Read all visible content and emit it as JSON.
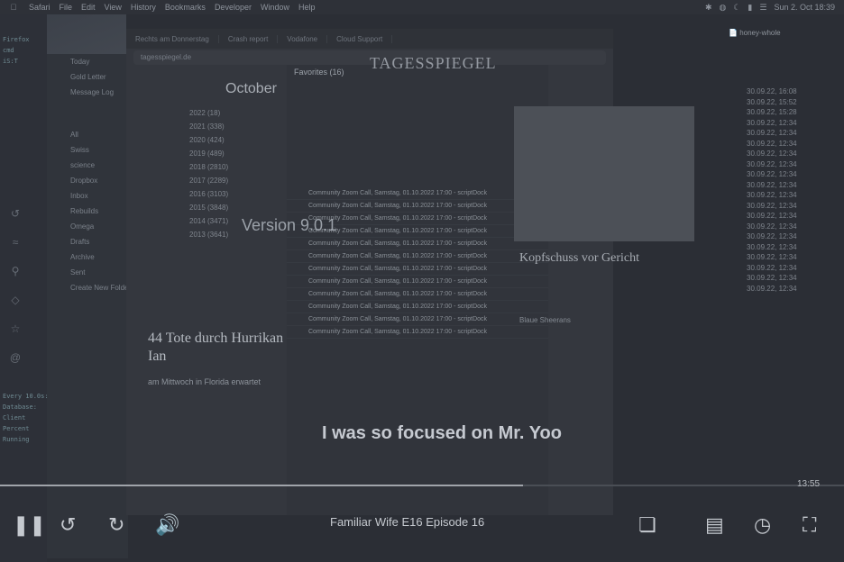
{
  "menubar": {
    "apple_icon": "apple-logo",
    "items": [
      "Safari",
      "File",
      "Edit",
      "View",
      "History",
      "Bookmarks",
      "Developer",
      "Window",
      "Help"
    ],
    "datetime": "Sun 2. Oct  18:39",
    "status_icons": [
      "bluetooth-icon",
      "wifi-icon",
      "moon-icon",
      "battery-icon",
      "control-center-icon"
    ]
  },
  "terminal": {
    "lines": [
      "Firefox",
      "cmd",
      "iS:T",
      "Every 10.0s: ss",
      "Database:",
      "Client",
      "Percent",
      "Running"
    ]
  },
  "mail": {
    "folders": [
      "Today",
      "Gold Letter",
      "Message Log",
      "All",
      "Swiss",
      "science",
      "Dropbox",
      "Inbox",
      "Rebuilds",
      "Omega",
      "Drafts",
      "Archive",
      "Sent",
      "Create New Folder"
    ]
  },
  "browser": {
    "tabs": [
      "Rechts am Donnerstag",
      "Crash report",
      "Vodafone",
      "Cloud Support"
    ],
    "url": "tagesspiegel.de"
  },
  "years": {
    "header": "October",
    "items": [
      "2022 (18)",
      "2021 (338)",
      "2020 (424)",
      "2019 (489)",
      "2018 (2810)",
      "2017 (2289)",
      "2016 (3103)",
      "2015 (3848)",
      "2014 (3471)",
      "2013 (3641)"
    ]
  },
  "news": {
    "version_text": "Version 9.0.1",
    "headline": "44 Tote durch Hurrikan Ian",
    "subhead": "am Mittwoch in Florida erwartet"
  },
  "feed": {
    "header": "Favorites (16)",
    "rows": [
      "Community Zoom Call, Samstag, 01.10.2022 17:00 - scriptDock",
      "Community Zoom Call, Samstag, 01.10.2022 17:00 - scriptDock",
      "Community Zoom Call, Samstag, 01.10.2022 17:00 - scriptDock",
      "Community Zoom Call, Samstag, 01.10.2022 17:00 - scriptDock",
      "Community Zoom Call, Samstag, 01.10.2022 17:00 - scriptDock",
      "Community Zoom Call, Samstag, 01.10.2022 17:00 - scriptDock",
      "Community Zoom Call, Samstag, 01.10.2022 17:00 - scriptDock",
      "Community Zoom Call, Samstag, 01.10.2022 17:00 - scriptDock",
      "Community Zoom Call, Samstag, 01.10.2022 17:00 - scriptDock",
      "Community Zoom Call, Samstag, 01.10.2022 17:00 - scriptDock",
      "Community Zoom Call, Samstag, 01.10.2022 17:00 - scriptDock",
      "Community Zoom Call, Samstag, 01.10.2022 17:00 - scriptDock"
    ]
  },
  "paper": {
    "title": "TAGESSPIEGEL",
    "headline": "Kopfschuss vor Gericht",
    "body": "Blaue Sheerans"
  },
  "right_list": {
    "doc_name": "honey-whole",
    "rows": [
      "30.09.22, 16:08",
      "30.09.22, 15:52",
      "30.09.22, 15:28",
      "30.09.22, 12:34",
      "30.09.22, 12:34",
      "30.09.22, 12:34",
      "30.09.22, 12:34",
      "30.09.22, 12:34",
      "30.09.22, 12:34",
      "30.09.22, 12:34",
      "30.09.22, 12:34",
      "30.09.22, 12:34",
      "30.09.22, 12:34",
      "30.09.22, 12:34",
      "30.09.22, 12:34",
      "30.09.22, 12:34",
      "30.09.22, 12:34",
      "30.09.22, 12:34",
      "30.09.22, 12:34",
      "30.09.22, 12:34"
    ]
  },
  "player": {
    "subtitle": "I was so focused on Mr. Yoo",
    "episode_title": "Familiar Wife E16 Episode 16",
    "time": "13:55",
    "progress": 0.62,
    "icons": [
      "pause-icon",
      "skip-back-10-icon",
      "skip-forward-10-icon",
      "volume-icon",
      "episodes-icon",
      "subtitles-icon",
      "speed-icon",
      "fullscreen-icon"
    ]
  }
}
